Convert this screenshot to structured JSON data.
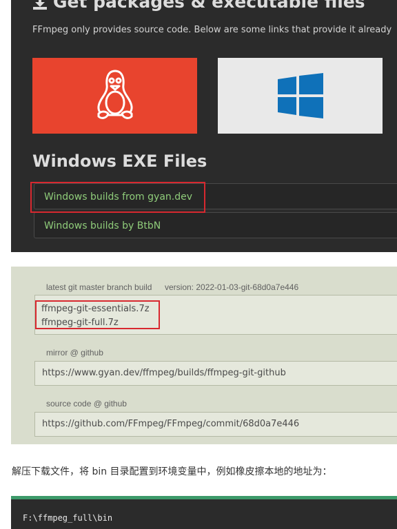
{
  "ffmpeg_section": {
    "title": "Get packages & executable files",
    "description": "FFmpeg only provides source code. Below are some links that provide it already",
    "tiles": [
      {
        "icon": "linux-tux-icon",
        "color": "#e8442e"
      },
      {
        "icon": "windows-logo-icon",
        "color": "#e9e9e9"
      }
    ],
    "exe_heading": "Windows EXE Files",
    "build_links": [
      "Windows builds from gyan.dev",
      "Windows builds by BtbN"
    ],
    "link_color": "#8fcc7a"
  },
  "gyan_section": {
    "build_label": "latest git master branch build",
    "version_label": "version: 2022-01-03-git-68d0a7e446",
    "files": [
      "ffmpeg-git-essentials.7z",
      "ffmpeg-git-full.7z"
    ],
    "mirror_label": "mirror @ github",
    "mirror_url": "https://www.gyan.dev/ffmpeg/builds/ffmpeg-git-github",
    "source_label": "source code @ github",
    "source_url": "https://github.com/FFmpeg/FFmpeg/commit/68d0a7e446"
  },
  "instruction": "解压下载文件，将 bin 目录配置到环境变量中，例如橡皮擦本地的地址为：",
  "code": "F:\\ffmpeg_full\\bin",
  "highlight_color": "#d8282f"
}
